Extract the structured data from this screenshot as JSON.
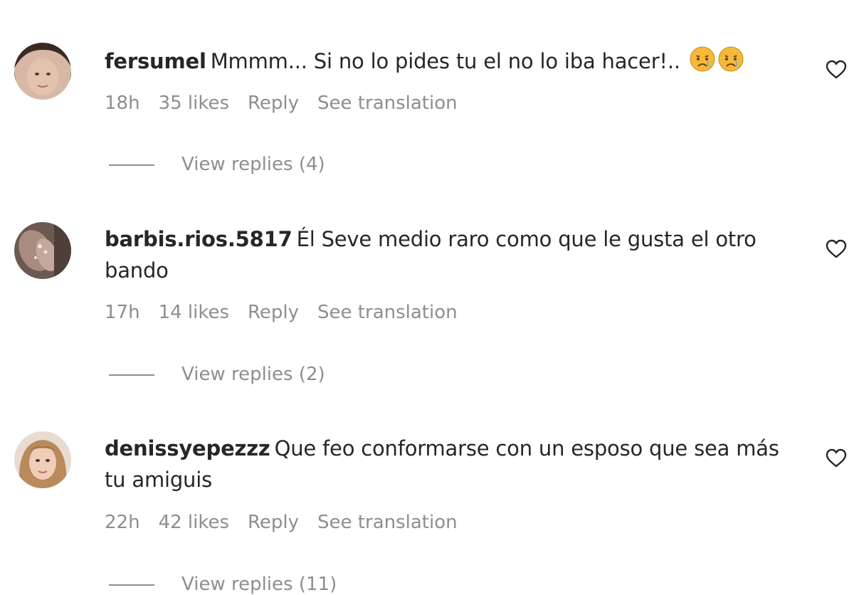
{
  "comments": [
    {
      "username": "fersumel",
      "text": "Mmmm... Si no lo pides tu el no lo iba hacer!..",
      "emojis": [
        "crying-face",
        "crying-face"
      ],
      "time": "18h",
      "likes": "35 likes",
      "reply": "Reply",
      "translate": "See translation",
      "view_replies": "View replies (4)"
    },
    {
      "username": "barbis.rios.5817",
      "text": "Él Seve medio raro como que le gusta el otro bando",
      "time": "17h",
      "likes": "14 likes",
      "reply": "Reply",
      "translate": "See translation",
      "view_replies": "View replies (2)"
    },
    {
      "username": "denissyepezzz",
      "text": "Que feo conformarse con un esposo que sea más tu amiguis",
      "time": "22h",
      "likes": "42 likes",
      "reply": "Reply",
      "translate": "See translation",
      "view_replies": "View replies (11)"
    }
  ],
  "colors": {
    "text": "#262626",
    "secondary": "#8e8e8e",
    "background": "#ffffff"
  },
  "icons": {
    "like": "heart-outline-icon",
    "emoji": "crying-face-emoji"
  }
}
